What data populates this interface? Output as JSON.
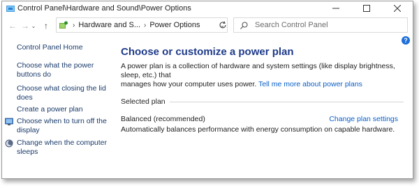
{
  "window": {
    "title": "Control Panel\\Hardware and Sound\\Power Options",
    "minimize_icon": "minimize-icon",
    "maximize_icon": "maximize-icon",
    "close_icon": "close-icon"
  },
  "navigation": {
    "back_icon": "back-arrow-icon",
    "forward_icon": "forward-arrow-icon",
    "up_icon": "up-arrow-icon",
    "breadcrumbs": [
      "Hardware and S...",
      "Power Options"
    ],
    "refresh_icon": "refresh-icon"
  },
  "search": {
    "placeholder": "Search Control Panel",
    "value": ""
  },
  "sidebar": {
    "home": "Control Panel Home",
    "items": [
      {
        "label_line1": "Choose what the power",
        "label_line2": "buttons do"
      },
      {
        "label_line1": "Choose what closing the lid",
        "label_line2": "does"
      },
      {
        "label_line1": "Create a power plan",
        "label_line2": ""
      },
      {
        "label_line1": "Choose when to turn off the",
        "label_line2": "display",
        "icon": "display-icon"
      },
      {
        "label_line1": "Change when the computer",
        "label_line2": "sleeps",
        "icon": "moon-icon"
      }
    ]
  },
  "main": {
    "heading": "Choose or customize a power plan",
    "description_line1": "A power plan is a collection of hardware and system settings (like display brightness, sleep, etc.) that",
    "description_line2": "manages how your computer uses power.",
    "learn_more_link": "Tell me more about power plans",
    "selected_plan_label": "Selected plan",
    "plan_name": "Balanced (recommended)",
    "change_plan_link": "Change plan settings",
    "plan_description": "Automatically balances performance with energy consumption on capable hardware."
  },
  "colors": {
    "link": "#0a5fc7",
    "heading": "#1e3a8a",
    "sidebar_link": "#1a3a6b",
    "help_badge": "#1e6fd9"
  }
}
